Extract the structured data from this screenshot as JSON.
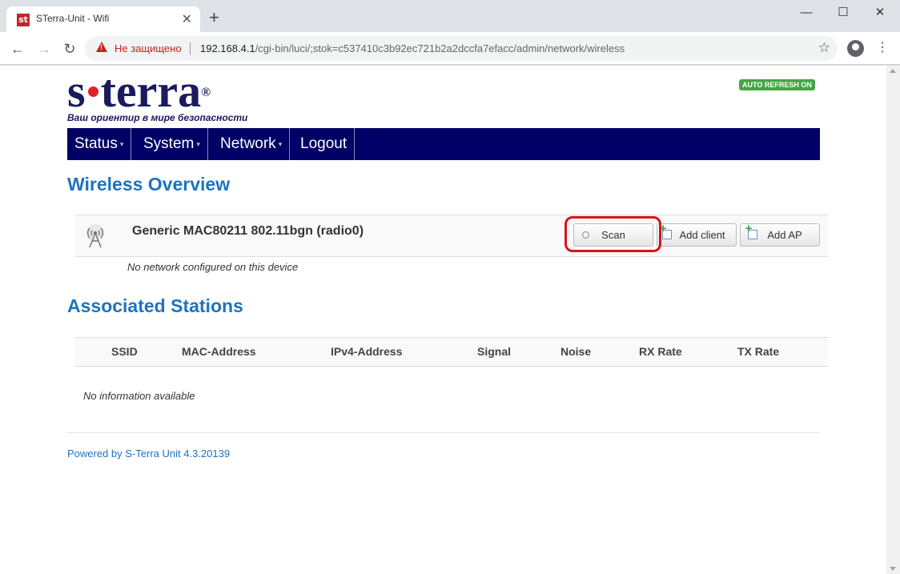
{
  "browser": {
    "tab_title": "STerra-Unit - Wifi",
    "favicon_text": "st",
    "tab_close": "✕",
    "new_tab": "+",
    "window": {
      "minimize": "—",
      "maximize": "☐",
      "close": "✕"
    },
    "back": "←",
    "forward": "→",
    "reload": "↻",
    "not_secure_label": "Не защищено",
    "url_host": "192.168.4.1",
    "url_path": "/cgi-bin/luci/;stok=c537410c3b92ec721b2a2dccfa7efacc/admin/network/wireless",
    "star": "☆",
    "menu": "⋮"
  },
  "header": {
    "logo_part1": "s",
    "logo_part2": "terra",
    "logo_reg": "®",
    "tagline": "Ваш ориентир в мире безопасности",
    "auto_refresh": "AUTO REFRESH ON"
  },
  "menu": {
    "items": [
      {
        "label": "Status",
        "caret": "▾"
      },
      {
        "label": "System",
        "caret": "▾"
      },
      {
        "label": "Network",
        "caret": "▾"
      },
      {
        "label": "Logout",
        "caret": ""
      }
    ]
  },
  "wireless": {
    "title": "Wireless Overview",
    "radio_name": "Generic MAC80211 802.11bgn (radio0)",
    "scan_label": "Scan",
    "add_client_label": "Add client",
    "add_ap_label": "Add AP",
    "no_network": "No network configured on this device"
  },
  "stations": {
    "title": "Associated Stations",
    "columns": [
      "SSID",
      "MAC-Address",
      "IPv4-Address",
      "Signal",
      "Noise",
      "RX Rate",
      "TX Rate"
    ],
    "empty": "No information available"
  },
  "footer": {
    "text": "Powered by S-Terra Unit 4.3.20139"
  },
  "colors": {
    "menubar": "#000066",
    "heading": "#1e73be",
    "highlight": "#d7141c",
    "badge": "#46a546"
  }
}
